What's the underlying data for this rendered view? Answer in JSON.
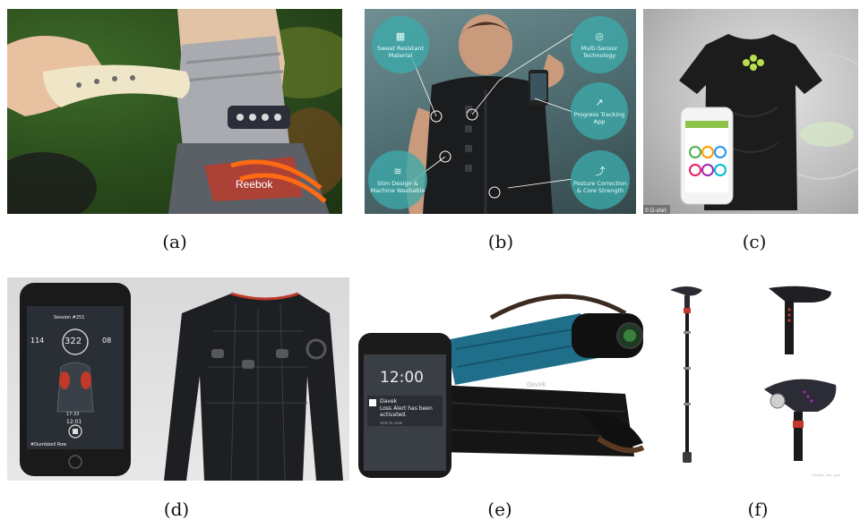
{
  "captions": {
    "a": "(a)",
    "b": "(b)",
    "c": "(c)",
    "d": "(d)",
    "e": "(e)",
    "f": "(f)"
  },
  "panel_a": {
    "shoe_brand": "Reebok"
  },
  "panel_b": {
    "bubbles": [
      "Sweat Resistant Material",
      "Multi-Sensor Technology",
      "Progress Tracking App",
      "Slim Design & Machine Washable",
      "Posture Correction & Core Strength"
    ]
  },
  "panel_c": {
    "watermark": "© D-shirt"
  },
  "panel_d": {
    "session": "Session #251",
    "count": "322",
    "left_stat": "114",
    "right_stat": "08",
    "time1": "17:33",
    "time2": "12:01",
    "exercise": "#Dumbbell Row"
  },
  "panel_e": {
    "clock": "12:00",
    "notif_app": "Davek",
    "notif_msg": "Loss Alert has been activated.",
    "notif_hint": "slide to view",
    "brand": "davek"
  },
  "panel_f": {
    "watermark": "©Iclustr_find_spot"
  }
}
